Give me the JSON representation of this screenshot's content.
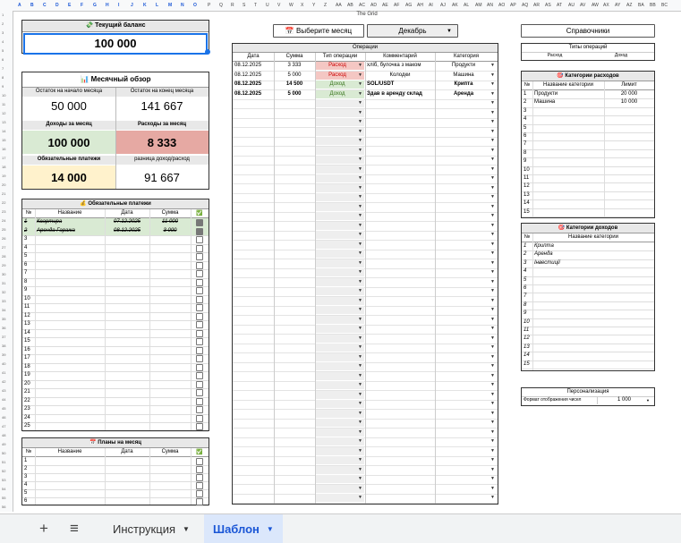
{
  "sheet": {
    "grid_title": "The Grid",
    "column_letters": [
      "A",
      "B",
      "C",
      "D",
      "E",
      "F",
      "G",
      "H",
      "I",
      "J",
      "K",
      "L",
      "M",
      "N",
      "O",
      "P",
      "Q",
      "R",
      "S",
      "T",
      "U",
      "V",
      "W",
      "X",
      "Y",
      "Z",
      "AA",
      "AB",
      "AC",
      "AD",
      "AE",
      "AF",
      "AG",
      "AH",
      "AI",
      "AJ",
      "AK",
      "AL",
      "AM",
      "AN",
      "AO",
      "AP",
      "AQ",
      "AR",
      "AS",
      "AT",
      "AU",
      "AV",
      "AW",
      "AX",
      "AY",
      "AZ",
      "BA",
      "BB",
      "BC"
    ]
  },
  "balance": {
    "title": "💸 Текущий баланс",
    "value": "100 000"
  },
  "monthly": {
    "title": "📊 Месячный обзор",
    "start_label": "Остаток на начало месяца",
    "start_value": "50 000",
    "end_label": "Остаток на конец месяца",
    "end_value": "141 667",
    "income_label": "Доходы за месяц",
    "income_value": "100 000",
    "expense_label": "Расходы за месяц",
    "expense_value": "8 333",
    "mandatory_label": "Обязательные платежи",
    "mandatory_value": "14 000",
    "diff_label": "разница доход/расход",
    "diff_value": "91 667"
  },
  "mandatory": {
    "title": "💰 Обязательные платежи",
    "headers": [
      "№",
      "Название",
      "Дата",
      "Сумма",
      "✅"
    ],
    "rows": [
      {
        "n": "1",
        "name": "Квартира",
        "date": "07.12.2025",
        "sum": "11 000",
        "done": true
      },
      {
        "n": "2",
        "name": "Аренда Гаража",
        "date": "08.12.2025",
        "sum": "3 000",
        "done": true
      },
      {
        "n": "3"
      },
      {
        "n": "4"
      },
      {
        "n": "5"
      },
      {
        "n": "6"
      },
      {
        "n": "7"
      },
      {
        "n": "8"
      },
      {
        "n": "9"
      },
      {
        "n": "10"
      },
      {
        "n": "11"
      },
      {
        "n": "12"
      },
      {
        "n": "13"
      },
      {
        "n": "14"
      },
      {
        "n": "15"
      },
      {
        "n": "16"
      },
      {
        "n": "17"
      },
      {
        "n": "18"
      },
      {
        "n": "19"
      },
      {
        "n": "20"
      },
      {
        "n": "21"
      },
      {
        "n": "22"
      },
      {
        "n": "23"
      },
      {
        "n": "24"
      },
      {
        "n": "25"
      }
    ]
  },
  "plans": {
    "title": "📅 Планы на месяц",
    "headers": [
      "№",
      "Название",
      "Дата",
      "Сумма",
      "✅"
    ],
    "rows": [
      {
        "n": "1"
      },
      {
        "n": "2"
      },
      {
        "n": "3"
      },
      {
        "n": "4"
      },
      {
        "n": "5"
      },
      {
        "n": "6"
      }
    ]
  },
  "month_select": {
    "button_label": "📅 Выберите месяц",
    "selected": "Декабрь"
  },
  "operations": {
    "title": "Операции",
    "headers": [
      "Дата",
      "Сумма",
      "Тип операции",
      "Комментарий",
      "Категория"
    ],
    "rows": [
      {
        "date": "08.12.2025",
        "sum": "3 333",
        "type": "Расход",
        "comment": "хліб, булочка з маком",
        "category": "Продукти"
      },
      {
        "date": "08.12.2025",
        "sum": "5 000",
        "type": "Расход",
        "comment": "Колодки",
        "category": "Машина"
      },
      {
        "date": "08.12.2025",
        "sum": "14 500",
        "type": "Доход",
        "comment": "SOL/USDT",
        "category": "Крипта"
      },
      {
        "date": "08.12.2025",
        "sum": "5 000",
        "type": "Доход",
        "comment": "Здав в аренду склад",
        "category": "Аренда"
      }
    ],
    "empty_rows": 46
  },
  "references": {
    "button_label": "Справочники",
    "types_title": "Типы операций",
    "types": [
      "Расход",
      "Доход"
    ],
    "expense_title": "🎯 Категории расходов",
    "expense_headers": [
      "№",
      "Название категории",
      "Лимит"
    ],
    "expense_rows": [
      {
        "n": "1",
        "name": "Продукти",
        "limit": "20 000"
      },
      {
        "n": "2",
        "name": "Машина",
        "limit": "10 000"
      },
      {
        "n": "3"
      },
      {
        "n": "4"
      },
      {
        "n": "5"
      },
      {
        "n": "6"
      },
      {
        "n": "7"
      },
      {
        "n": "8"
      },
      {
        "n": "9"
      },
      {
        "n": "10"
      },
      {
        "n": "11"
      },
      {
        "n": "12"
      },
      {
        "n": "13"
      },
      {
        "n": "14"
      },
      {
        "n": "15"
      }
    ],
    "income_title": "🎯 Категории доходов",
    "income_headers": [
      "№",
      "Название категории"
    ],
    "income_rows": [
      {
        "n": "1",
        "name": "Крипта"
      },
      {
        "n": "2",
        "name": "Аренда"
      },
      {
        "n": "3",
        "name": "Інвестиції"
      },
      {
        "n": "4"
      },
      {
        "n": "5"
      },
      {
        "n": "6"
      },
      {
        "n": "7"
      },
      {
        "n": "8"
      },
      {
        "n": "9"
      },
      {
        "n": "10"
      },
      {
        "n": "11"
      },
      {
        "n": "12"
      },
      {
        "n": "13"
      },
      {
        "n": "14"
      },
      {
        "n": "15"
      }
    ],
    "personal_title": "Персонализация",
    "format_label": "Формат отображения чисел",
    "format_value": "1 000"
  },
  "tabs": {
    "add_icon": "+",
    "menu_icon": "≡",
    "items": [
      {
        "label": "Инструкция",
        "active": false
      },
      {
        "label": "Шаблон",
        "active": true
      }
    ]
  },
  "colors": {
    "expense_red": "#f4c7c3",
    "income_green": "#d9ead3",
    "mandatory_yellow": "#fff2cc",
    "selection_blue": "#1a73e8"
  }
}
